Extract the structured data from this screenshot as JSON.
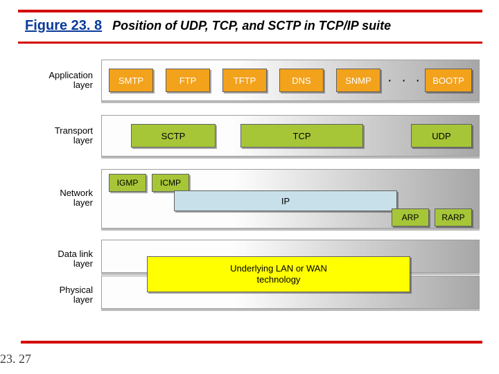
{
  "title": {
    "label": "Figure 23. 8",
    "caption": "Position of UDP, TCP, and SCTP in TCP/IP suite"
  },
  "layers": {
    "application": {
      "label_l1": "Application",
      "label_l2": "layer",
      "boxes": [
        "SMTP",
        "FTP",
        "TFTP",
        "DNS",
        "SNMP",
        "BOOTP"
      ],
      "ellipsis": "· · ·"
    },
    "transport": {
      "label_l1": "Transport",
      "label_l2": "layer",
      "boxes": [
        "SCTP",
        "TCP",
        "UDP"
      ]
    },
    "network": {
      "label_l1": "Network",
      "label_l2": "layer",
      "top_boxes": [
        "IGMP",
        "ICMP"
      ],
      "center": "IP",
      "bottom_boxes": [
        "ARP",
        "RARP"
      ]
    },
    "datalink": {
      "label_l1": "Data link",
      "label_l2": "layer"
    },
    "physical": {
      "label_l1": "Physical",
      "label_l2": "layer"
    },
    "underlying": "Underlying LAN or WAN\ntechnology"
  },
  "page_number": "23. 27"
}
